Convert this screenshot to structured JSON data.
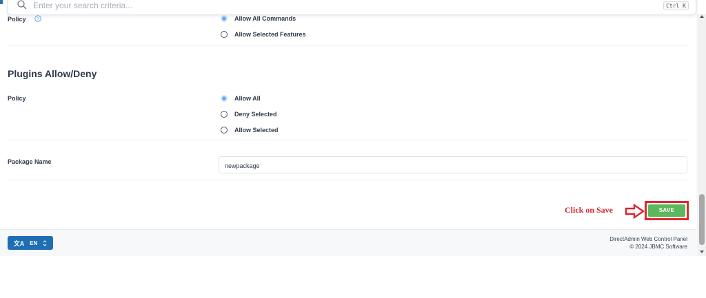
{
  "search": {
    "placeholder": "Enter your search criteria...",
    "shortcut": "Ctrl K",
    "icon": "search-icon"
  },
  "commands_policy": {
    "label": "Policy",
    "help_icon": "question-circle-icon",
    "options": [
      {
        "label": "Allow All Commands",
        "checked": true
      },
      {
        "label": "Allow Selected Features",
        "checked": false
      }
    ]
  },
  "plugins": {
    "title": "Plugins Allow/Deny",
    "policy_label": "Policy",
    "options": [
      {
        "label": "Allow All",
        "checked": true
      },
      {
        "label": "Deny Selected",
        "checked": false
      },
      {
        "label": "Allow Selected",
        "checked": false
      }
    ]
  },
  "package": {
    "label": "Package Name",
    "value": "newpackage"
  },
  "save": {
    "label": "SAVE",
    "color": "#5cb85c"
  },
  "annotation": {
    "text": "Click on Save",
    "color": "#d9252c"
  },
  "footer": {
    "language": "EN",
    "language_icon": "translate-icon",
    "line1": "DirectAdmin Web Control Panel",
    "line2": "© 2024 JBMC Software"
  },
  "colors": {
    "accent": "#1f6eb4",
    "radio_checked": "#5aa9f0"
  }
}
